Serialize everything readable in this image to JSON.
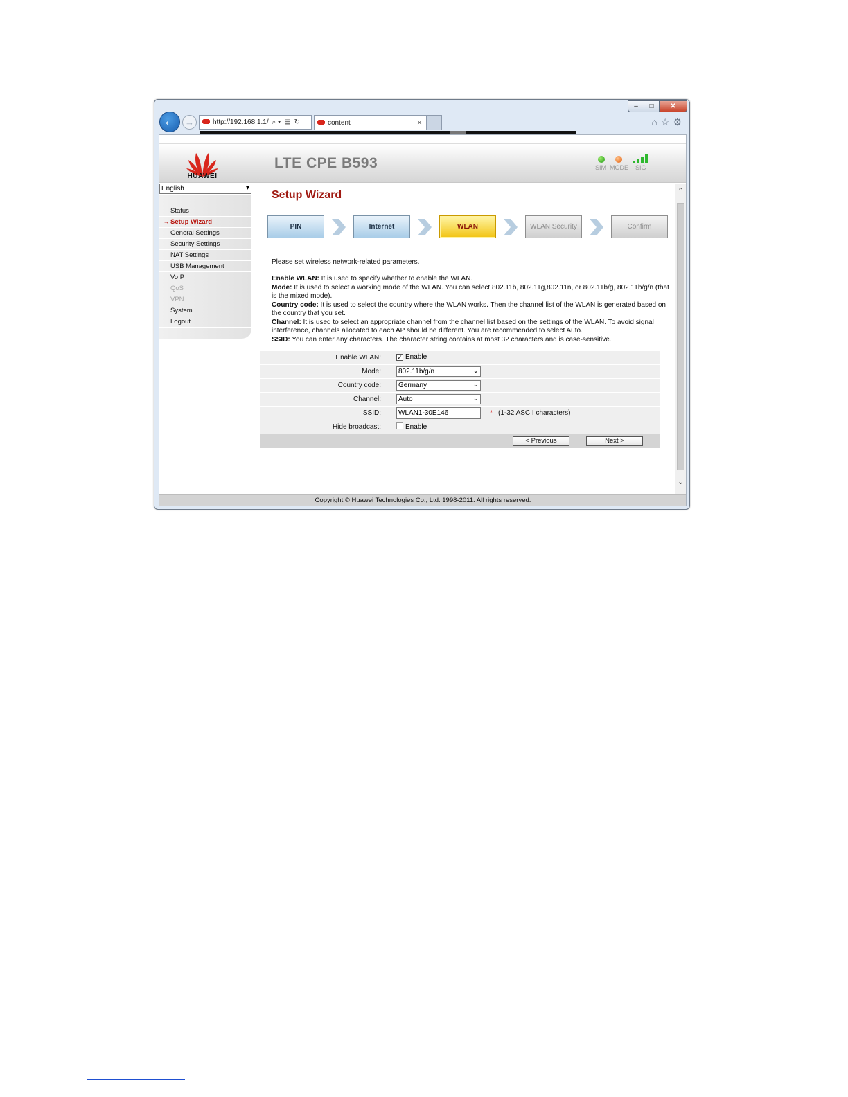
{
  "browser": {
    "address_url": "http://192.168.1.1/",
    "tab_title": "content"
  },
  "header": {
    "brand": "HUAWEI",
    "product": "LTE CPE B593",
    "indicators": {
      "sim_label": "SIM",
      "mode_label": "MODE",
      "sig_label": "SIG",
      "sim_color": "#1f9a15",
      "mode_color": "#e35d0a",
      "sig_color": "#2eb82e"
    }
  },
  "sidebar": {
    "language": "English",
    "items": [
      {
        "label": "Status",
        "state": "normal"
      },
      {
        "label": "Setup Wizard",
        "state": "active"
      },
      {
        "label": "General Settings",
        "state": "normal"
      },
      {
        "label": "Security Settings",
        "state": "normal"
      },
      {
        "label": "NAT Settings",
        "state": "normal"
      },
      {
        "label": "USB Management",
        "state": "normal"
      },
      {
        "label": "VoIP",
        "state": "normal"
      },
      {
        "label": "QoS",
        "state": "disabled"
      },
      {
        "label": "VPN",
        "state": "disabled"
      },
      {
        "label": "System",
        "state": "normal"
      },
      {
        "label": "Logout",
        "state": "normal"
      }
    ]
  },
  "page": {
    "title": "Setup Wizard",
    "steps": [
      {
        "label": "PIN",
        "state": "done"
      },
      {
        "label": "Internet",
        "state": "done"
      },
      {
        "label": "WLAN",
        "state": "current"
      },
      {
        "label": "WLAN Security",
        "state": "future"
      },
      {
        "label": "Confirm",
        "state": "future"
      }
    ],
    "intro": "Please set wireless network-related parameters.",
    "help": {
      "enable_wlan_term": "Enable WLAN:",
      "enable_wlan_text": " It is used to specify whether to enable the WLAN.",
      "mode_term": "Mode:",
      "mode_text": " It is used to select a working mode of the WLAN. You can select 802.11b, 802.11g,802.11n, or 802.11b/g, 802.11b/g/n (that is the mixed mode).",
      "country_term": "Country code:",
      "country_text": " It is used to select the country where the WLAN works. Then the channel list of the WLAN is generated based on the country that you set.",
      "channel_term": "Channel:",
      "channel_text": " It is used to select an appropriate channel from the channel list based on the settings of the WLAN. To avoid signal interference, channels allocated to each AP should be different. You are recommended to select Auto.",
      "ssid_term": "SSID:",
      "ssid_text": " You can enter any characters. The character string contains at most 32 characters and is case-sensitive."
    },
    "form": {
      "enable_wlan_label": "Enable WLAN:",
      "enable_wlan_option": "Enable",
      "enable_wlan_checked": true,
      "mode_label": "Mode:",
      "mode_value": "802.11b/g/n",
      "country_label": "Country code:",
      "country_value": "Germany",
      "channel_label": "Channel:",
      "channel_value": "Auto",
      "ssid_label": "SSID:",
      "ssid_value": "WLAN1-30E146",
      "ssid_required": "*",
      "ssid_hint": "(1-32 ASCII characters)",
      "hide_label": "Hide broadcast:",
      "hide_option": "Enable",
      "hide_checked": false
    },
    "buttons": {
      "previous": "< Previous",
      "next": "Next >"
    }
  },
  "footer": {
    "copyright": "Copyright © Huawei Technologies Co., Ltd. 1998-2011. All rights reserved."
  }
}
